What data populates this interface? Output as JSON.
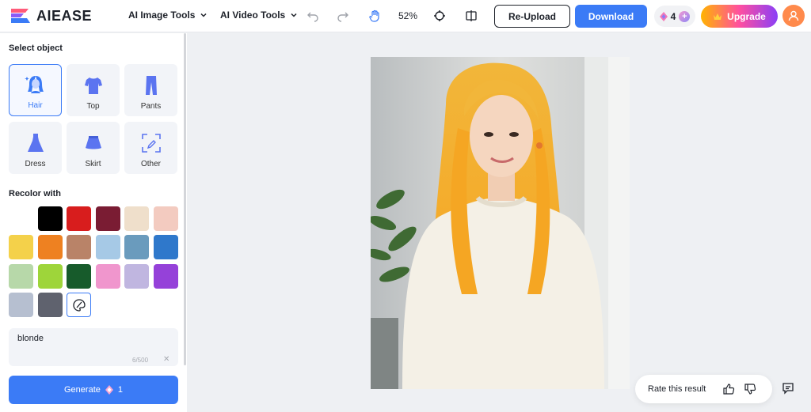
{
  "header": {
    "logo_text": "AIEASE",
    "nav": [
      {
        "label": "AI Image Tools"
      },
      {
        "label": "AI Video Tools"
      }
    ],
    "zoom": "52%",
    "reupload_label": "Re-Upload",
    "download_label": "Download",
    "credits": "4",
    "upgrade_label": "Upgrade"
  },
  "sidebar": {
    "select_title": "Select object",
    "objects": [
      {
        "label": "Hair",
        "icon": "hair-icon",
        "active": true
      },
      {
        "label": "Top",
        "icon": "top-icon",
        "active": false
      },
      {
        "label": "Pants",
        "icon": "pants-icon",
        "active": false
      },
      {
        "label": "Dress",
        "icon": "dress-icon",
        "active": false
      },
      {
        "label": "Skirt",
        "icon": "skirt-icon",
        "active": false
      },
      {
        "label": "Other",
        "icon": "other-icon",
        "active": false
      }
    ],
    "recolor_title": "Recolor with",
    "colors": [
      "#000000",
      "#d81d1d",
      "#7a1c33",
      "#efdfcb",
      "#f3cbc0",
      "#f4d14a",
      "#ee8121",
      "#b98368",
      "#a6c9e6",
      "#6a9bbd",
      "#2f78cb",
      "#b7d8a9",
      "#9ed53a",
      "#175b2b",
      "#f096cd",
      "#c0b6e0",
      "#9541d9",
      "#b6bfd0",
      "#5f626e"
    ],
    "prompt_value": "blonde",
    "prompt_count": "6/500",
    "generate_label": "Generate",
    "generate_cost": "1"
  },
  "canvas": {
    "rate_label": "Rate this result"
  },
  "accent": "#3b7bf6"
}
